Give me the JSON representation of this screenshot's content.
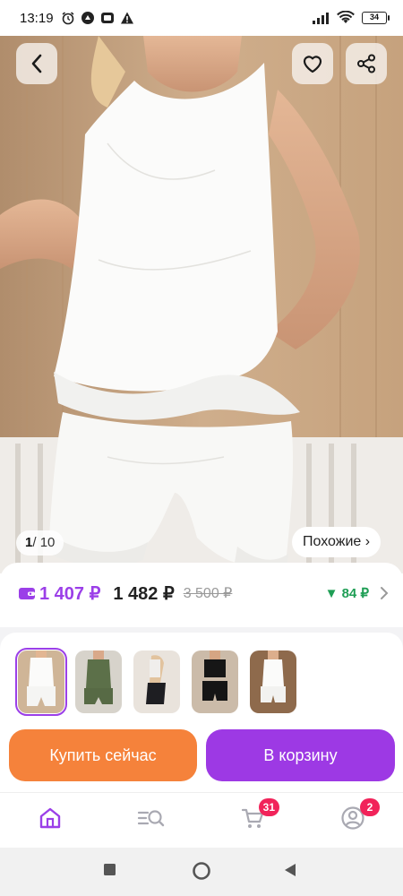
{
  "status_bar": {
    "time": "13:19",
    "battery": "34",
    "icons": [
      "alarm-icon",
      "drive-icon",
      "screen-record-icon",
      "warning-icon",
      "signal-icon",
      "wifi-icon",
      "battery-icon"
    ]
  },
  "gallery": {
    "current": "1",
    "separator": "/",
    "total": "10",
    "similar_label": "Похожие ›"
  },
  "price": {
    "wallet_price": "1 407 ₽",
    "price": "1 482 ₽",
    "old_price": "3 500 ₽",
    "cashback": "▼ 84 ₽"
  },
  "thumbnails": {
    "count": 5,
    "active_index": 0
  },
  "actions": {
    "buy_now": "Купить сейчас",
    "add_to_cart": "В корзину"
  },
  "bottom_nav": {
    "items": [
      "home-icon",
      "catalog-search-icon",
      "cart-icon",
      "profile-icon"
    ],
    "cart_badge": "31",
    "profile_badge": "2"
  },
  "colors": {
    "accent_purple": "#9b3fe8",
    "buy_orange": "#f5823b",
    "cart_purple": "#9d39e4",
    "cashback_green": "#1f9e55",
    "badge_red": "#f1235a"
  }
}
